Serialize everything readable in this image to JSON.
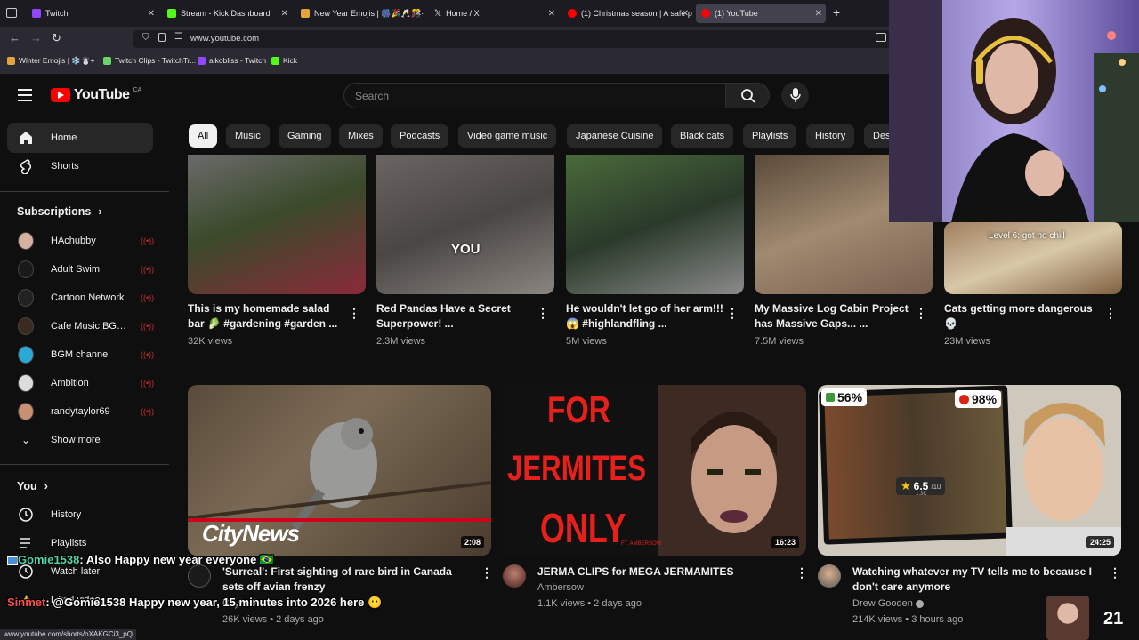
{
  "browser": {
    "tabs": [
      {
        "label": "Twitch",
        "fav": "#9146ff"
      },
      {
        "label": "Stream - Kick Dashboard",
        "fav": "#53fc18"
      },
      {
        "label": "New Year Emojis | 🎆🎉🥂🎊·",
        "fav": "#e3a43c"
      },
      {
        "label": "Home / X",
        "fav": "#000000"
      },
      {
        "label": "(1) Christmas season | A safe pla",
        "fav": "#ff0000"
      },
      {
        "label": "(1) YouTube",
        "fav": "#ff0000"
      }
    ],
    "url": "www.youtube.com",
    "bookmarks": [
      "Winter Emojis | ❄️☃️+",
      "Twitch Clips - TwitchTr...",
      "aikobliss - Twitch",
      "Kick"
    ],
    "status_url": "www.youtube.com/shorts/oXAKGCi3_pQ"
  },
  "youtube": {
    "logo": "YouTube",
    "country": "CA",
    "search_placeholder": "Search",
    "sidebar": {
      "home": "Home",
      "shorts": "Shorts",
      "subscriptions_header": "Subscriptions",
      "subs": [
        {
          "name": "HAchubby",
          "color": "#d8b0a0"
        },
        {
          "name": "Adult Swim",
          "color": "#1a1a1a"
        },
        {
          "name": "Cartoon Network",
          "color": "#222222"
        },
        {
          "name": "Cafe Music BGM...",
          "color": "#3a2a20"
        },
        {
          "name": "BGM channel",
          "color": "#2aa8d8"
        },
        {
          "name": "Ambition",
          "color": "#dddddd"
        },
        {
          "name": "randytaylor69",
          "color": "#c89070"
        }
      ],
      "show_more": "Show more",
      "you_header": "You",
      "history": "History",
      "playlists": "Playlists",
      "watch_later": "Watch later",
      "liked": "Liked videos"
    },
    "chips": [
      "All",
      "Music",
      "Gaming",
      "Mixes",
      "Podcasts",
      "Video game music",
      "Japanese Cuisine",
      "Black cats",
      "Playlists",
      "History",
      "Des"
    ],
    "shorts": [
      {
        "title": "This is my homemade salad bar 🥬 #gardening #garden ...",
        "views": "32K views"
      },
      {
        "title": "Red Pandas Have a Secret Superpower! ...",
        "views": "2.3M views",
        "overlay": "YOU"
      },
      {
        "title": "He wouldn't let go of her arm!!! 😱 #highlandfling ...",
        "views": "5M views"
      },
      {
        "title": "My Massive Log Cabin Project has Massive Gaps... ...",
        "views": "7.5M views"
      },
      {
        "title": "Cats getting more dangerous 💀",
        "views": "23M views",
        "overlay": "Level 6: got no chill"
      }
    ],
    "videos": [
      {
        "title": "'Surreal': First sighting of rare bird in Canada sets off avian frenzy",
        "channel": "CityNews",
        "meta": "26K views • 2 days ago",
        "duration": "2:08",
        "brand": "CityNews"
      },
      {
        "title": "JERMA CLIPS for MEGA JERMAMITES",
        "channel": "Ambersow",
        "meta": "1.1K views • 2 days ago",
        "duration": "16:23",
        "thumb_text": [
          "FOR",
          "JERMITES",
          "ONLY"
        ],
        "thumb_small": "FT. AMBERSOW"
      },
      {
        "title": "Watching whatever my TV tells me to because I don't care anymore",
        "channel": "Drew Gooden",
        "meta": "214K views • 3 hours ago",
        "duration": "24:25",
        "pct1": "56%",
        "pct2": "98%",
        "rating": "6.5",
        "rating_of": "/10",
        "rating_count": "1.3K"
      }
    ]
  },
  "stream_overlay": {
    "chat": [
      {
        "user": "Gomie1538",
        "msg": ": Also Happy new year everyone 🇧🇷"
      },
      {
        "user": "Sinmet",
        "msg": ": @Gomie1538 Happy new year, 15 minutes into 2026 here 😶"
      }
    ],
    "corner_number": "21"
  }
}
